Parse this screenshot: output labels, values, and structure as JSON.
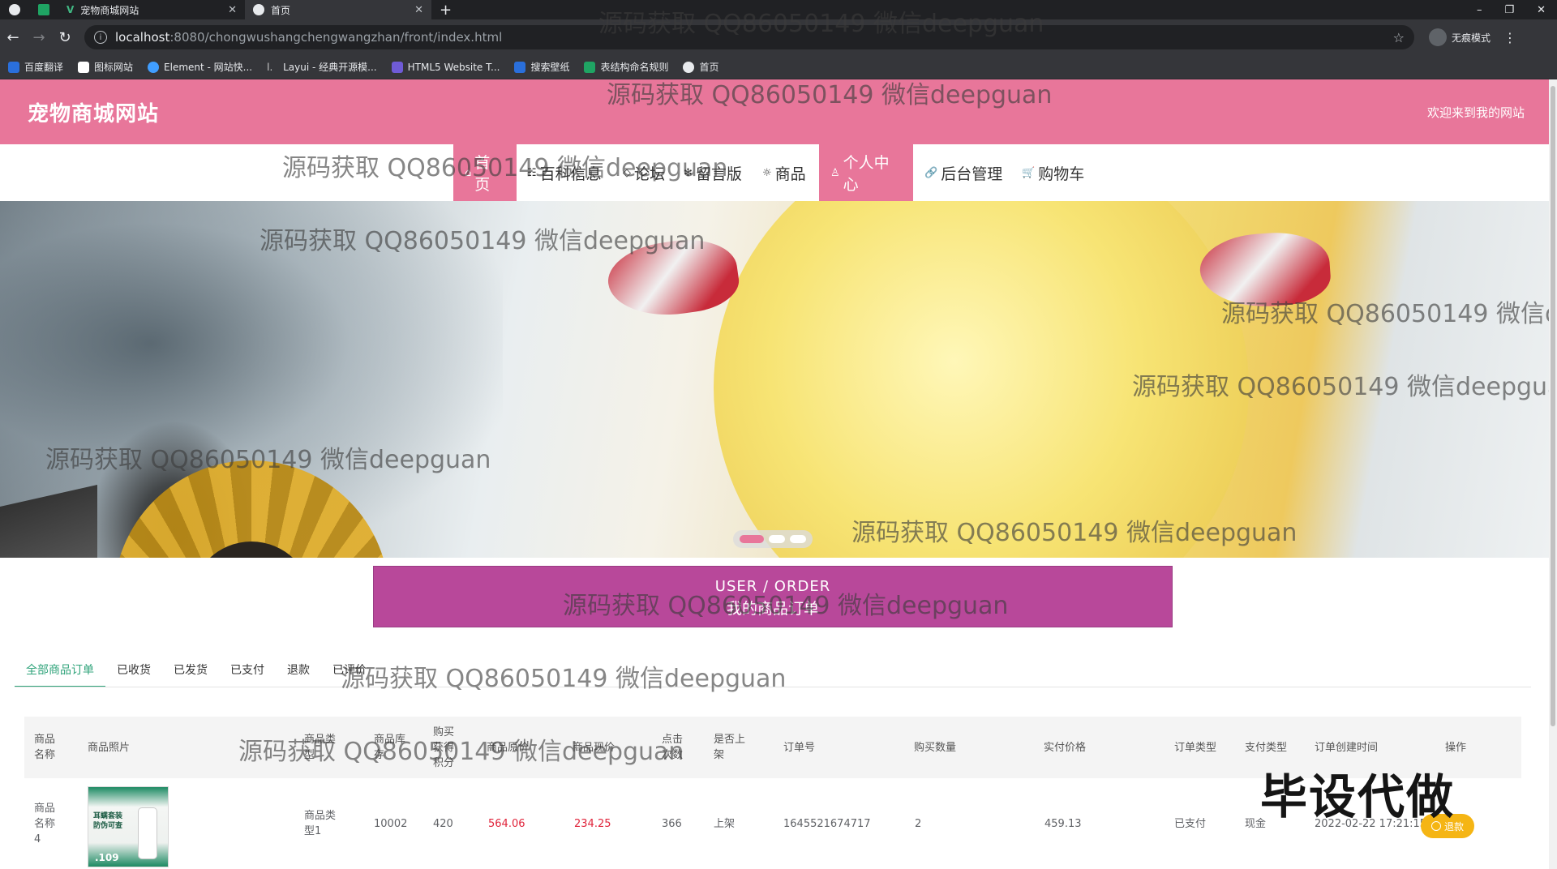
{
  "browser": {
    "tabs": [
      {
        "label": "宠物商城网站",
        "close": "✕"
      },
      {
        "label": "首页",
        "close": "✕"
      }
    ],
    "new_tab": "+",
    "url_host": "localhost",
    "url_path": ":8080/chongwushangchengwangzhan/front/index.html",
    "profile_label": "无痕模式",
    "window_controls": [
      "–",
      "❐",
      "✕"
    ],
    "bookmarks": [
      {
        "label": "百度翻译",
        "color": "#2a6fdb"
      },
      {
        "label": "图标网站",
        "color": "#ffffff"
      },
      {
        "label": "Element - 网站快...",
        "color": "#409eff"
      },
      {
        "label": "Layui - 经典开源模...",
        "color": "#ffffff"
      },
      {
        "label": "HTML5 Website T...",
        "color": "#6f5bd6"
      },
      {
        "label": "搜索壁纸",
        "color": "#2a6fdb"
      },
      {
        "label": "表结构命名规则",
        "color": "#1fa463"
      },
      {
        "label": "首页",
        "color": "#e8eaed"
      }
    ]
  },
  "site": {
    "title": "宠物商城网站",
    "welcome": "欢迎来到我的网站",
    "header_color": "#e8769a"
  },
  "nav": {
    "items": [
      {
        "label": "首页",
        "icon": "⌂"
      },
      {
        "label": "百科信息",
        "icon": "☷"
      },
      {
        "label": "论坛",
        "icon": "◇"
      },
      {
        "label": "留言版",
        "icon": "✻"
      },
      {
        "label": "商品",
        "icon": "☼"
      },
      {
        "label": "个人中心",
        "icon": "♙"
      },
      {
        "label": "后台管理",
        "icon": "🔗"
      },
      {
        "label": "购物车",
        "icon": "🛒"
      }
    ]
  },
  "order_section": {
    "title_en": "USER / ORDER",
    "title_cn": "我的商品订单",
    "color": "#b8489a"
  },
  "tabs": [
    {
      "label": "全部商品订单"
    },
    {
      "label": "已收货"
    },
    {
      "label": "已发货"
    },
    {
      "label": "已支付"
    },
    {
      "label": "退款"
    },
    {
      "label": "已评价"
    }
  ],
  "table": {
    "headers": [
      "商品\n名称",
      "商品照片",
      "商品类\n型",
      "商品库\n存",
      "购买\n获得\n积分",
      "商品原价",
      "商品现价",
      "点击\n次数",
      "是否上\n架",
      "订单号",
      "购买数量",
      "实付价格",
      "订单类型",
      "支付类型",
      "订单创建时间",
      "操作"
    ],
    "rows": [
      {
        "name": "商品\n名称\n4",
        "image_text": "耳螨套装\n防伪可查",
        "image_price": ".109",
        "type": "商品类\n型1",
        "stock": "10002",
        "points": "420",
        "old_price": "564.06",
        "new_price": "234.25",
        "clicks": "366",
        "on_shelf": "上架",
        "order_no": "1645521674717",
        "qty": "2",
        "paid": "459.13",
        "order_type": "已支付",
        "pay_type": "现金",
        "created": "2022-02-22 17:21:15",
        "action": "退款"
      }
    ]
  },
  "watermark": {
    "text": "源码获取 QQ86050149 微信deepguan",
    "badge": "毕设代做"
  }
}
